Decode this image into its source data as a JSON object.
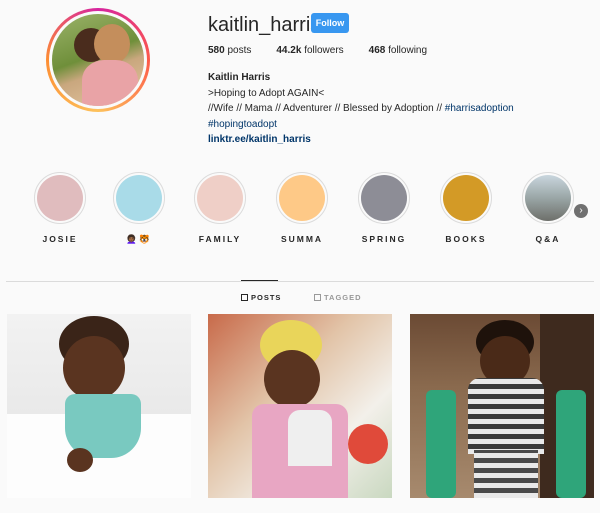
{
  "profile": {
    "username": "kaitlin_harris",
    "follow_label": "Follow",
    "stats": [
      {
        "value": "580",
        "label": "posts"
      },
      {
        "value": "44.2k",
        "label": "followers"
      },
      {
        "value": "468",
        "label": "following"
      }
    ],
    "bio": {
      "name": "Kaitlin Harris",
      "line1": ">Hoping to Adopt AGAIN<",
      "line2_text": "//Wife // Mama // Adventurer // Blessed by Adoption // ",
      "line2_tag": "#harrisadoption",
      "line3_tag": "#hopingtoadopt",
      "link": "linktr.ee/kaitlin_harris"
    }
  },
  "highlights": [
    {
      "label": "JOSIE",
      "color": "#e0bcbe"
    },
    {
      "label": "👩🏾‍🦱🐯",
      "color": "#a9dbe8"
    },
    {
      "label": "FAMILY",
      "color": "#efcfc7"
    },
    {
      "label": "SUMMA",
      "color": "#fec987"
    },
    {
      "label": "SPRING",
      "color": "#8d8d96"
    },
    {
      "label": "BOOKS",
      "color": "#d39a26"
    },
    {
      "label": "Q&A",
      "color": "#9aa6a6"
    }
  ],
  "highlights_next_icon": "chevron-right-icon",
  "tabs": {
    "posts": "POSTS",
    "tagged": "TAGGED"
  },
  "colors": {
    "accent": "#3897f0",
    "hashtag": "#003569"
  }
}
